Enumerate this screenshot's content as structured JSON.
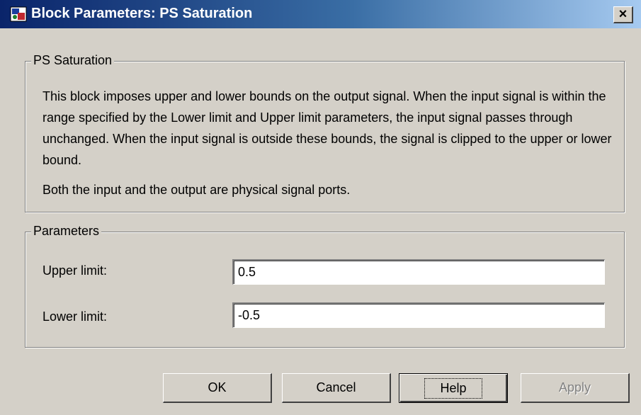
{
  "window": {
    "title": "Block Parameters: PS Saturation",
    "close_label": "×",
    "icon": "simulink-block-icon"
  },
  "description_group": {
    "legend": "PS Saturation",
    "paragraph1": "This block imposes upper and lower bounds on the output signal. When the input signal is within the range specified by the Lower limit and Upper limit parameters, the input signal passes through unchanged. When the input signal is outside these bounds, the signal is clipped to the upper or lower bound.",
    "paragraph2": "Both the input and the output are physical signal ports."
  },
  "parameters_group": {
    "legend": "Parameters",
    "upper_limit": {
      "label": "Upper limit:",
      "value": "0.5"
    },
    "lower_limit": {
      "label": "Lower limit:",
      "value": "-0.5"
    }
  },
  "buttons": {
    "ok": "OK",
    "cancel": "Cancel",
    "help": "Help",
    "apply": "Apply"
  },
  "colors": {
    "title_gradient_start": "#0a246a",
    "title_gradient_end": "#a6caf0",
    "dialog_background": "#d4d0c8",
    "disabled_text": "#808080"
  }
}
